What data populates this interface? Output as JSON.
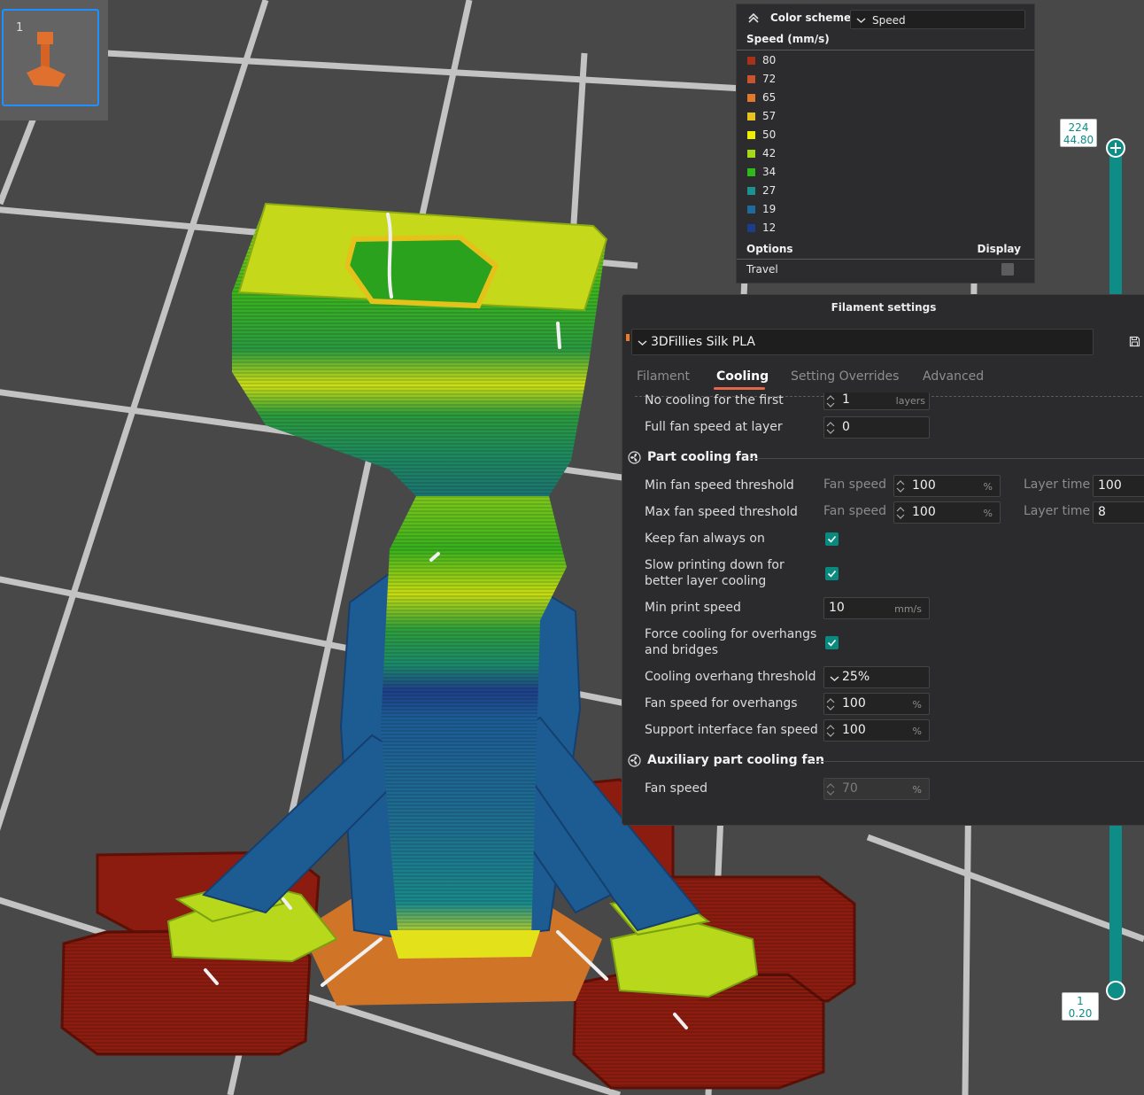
{
  "viewer": {
    "thumbnail_index": "1",
    "layer_slider": {
      "top_layer": "224",
      "top_height": "44.80",
      "bottom_layer": "1",
      "bottom_height": "0.20"
    }
  },
  "legend": {
    "title": "Color scheme",
    "scheme_value": "Speed",
    "speed_header": "Speed (mm/s)",
    "items": [
      {
        "value": "80",
        "color": "#a8311c"
      },
      {
        "value": "72",
        "color": "#c9532d"
      },
      {
        "value": "65",
        "color": "#e0782e"
      },
      {
        "value": "57",
        "color": "#e8c21c"
      },
      {
        "value": "50",
        "color": "#eeee00"
      },
      {
        "value": "42",
        "color": "#a6d816"
      },
      {
        "value": "34",
        "color": "#2fba1c"
      },
      {
        "value": "27",
        "color": "#1a928f"
      },
      {
        "value": "19",
        "color": "#1d6a9b"
      },
      {
        "value": "12",
        "color": "#1b3d8a"
      }
    ],
    "options_label": "Options",
    "display_label": "Display",
    "travel_label": "Travel"
  },
  "panel": {
    "title": "Filament settings",
    "preset": "3DFillies Silk PLA",
    "tabs": [
      "Filament",
      "Cooling",
      "Setting Overrides",
      "Advanced"
    ],
    "active_tab": "Cooling",
    "no_cooling_label": "No cooling for the first",
    "no_cooling_value": "1",
    "no_cooling_unit": "layers",
    "full_fan_label": "Full fan speed at layer",
    "full_fan_value": "0",
    "part_fan_header": "Part cooling fan",
    "min_fan_label": "Min fan speed threshold",
    "max_fan_label": "Max fan speed threshold",
    "fan_speed_sub": "Fan speed",
    "layer_time_sub": "Layer time",
    "min_fan_speed": "100",
    "max_fan_speed": "100",
    "min_layer_time": "100",
    "max_layer_time": "8",
    "percent": "%",
    "keep_fan_label": "Keep fan always on",
    "slow_down_label_1": "Slow printing down for",
    "slow_down_label_2": "better layer cooling",
    "min_print_speed_label": "Min print speed",
    "min_print_speed_value": "10",
    "min_print_speed_unit": "mm/s",
    "force_cooling_label_1": "Force cooling for overhangs",
    "force_cooling_label_2": "and bridges",
    "overhang_threshold_label": "Cooling overhang threshold",
    "overhang_threshold_value": "25%",
    "fan_overhangs_label": "Fan speed for overhangs",
    "fan_overhangs_value": "100",
    "support_fan_label": "Support interface fan speed",
    "support_fan_value": "100",
    "aux_header": "Auxiliary part cooling fan",
    "aux_fan_label": "Fan speed",
    "aux_fan_value": "70"
  }
}
